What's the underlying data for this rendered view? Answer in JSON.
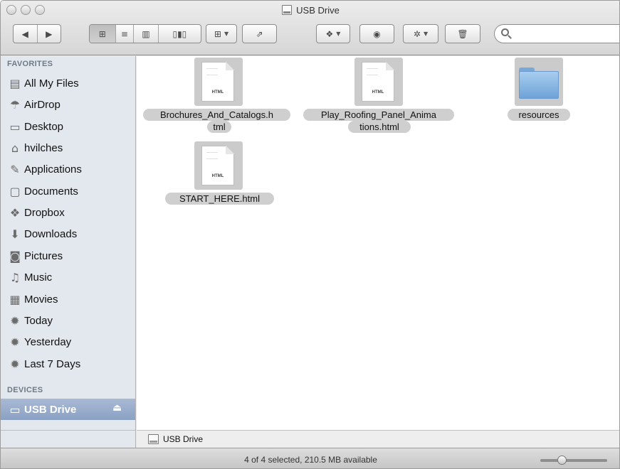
{
  "window": {
    "title": "USB Drive"
  },
  "toolbar": {
    "back_icon": "triangle-left-icon",
    "forward_icon": "triangle-right-icon",
    "views": [
      "icon-view",
      "list-view",
      "column-view",
      "coverflow-view"
    ],
    "active_view": "icon-view",
    "arrange_icon": "grid-icon",
    "share_icon": "share-icon",
    "dropbox_icon": "dropbox-icon",
    "quicklook_icon": "eye-icon",
    "action_icon": "gear-icon",
    "delete_icon": "trash-icon",
    "search_placeholder": ""
  },
  "sidebar": {
    "favorites_header": "FAVORITES",
    "favorites": [
      {
        "label": "All My Files",
        "icon": "all-files-icon"
      },
      {
        "label": "AirDrop",
        "icon": "airdrop-icon"
      },
      {
        "label": "Desktop",
        "icon": "desktop-icon"
      },
      {
        "label": "hvilches",
        "icon": "home-icon"
      },
      {
        "label": "Applications",
        "icon": "applications-icon"
      },
      {
        "label": "Documents",
        "icon": "documents-icon"
      },
      {
        "label": "Dropbox",
        "icon": "dropbox-icon"
      },
      {
        "label": "Downloads",
        "icon": "downloads-icon"
      },
      {
        "label": "Pictures",
        "icon": "camera-icon"
      },
      {
        "label": "Music",
        "icon": "music-icon"
      },
      {
        "label": "Movies",
        "icon": "film-icon"
      },
      {
        "label": "Today",
        "icon": "smart-folder-icon"
      },
      {
        "label": "Yesterday",
        "icon": "smart-folder-icon"
      },
      {
        "label": "Last 7 Days",
        "icon": "smart-folder-icon"
      }
    ],
    "devices_header": "DEVICES",
    "devices": [
      {
        "label": "USB Drive",
        "icon": "drive-icon",
        "selected": true
      }
    ]
  },
  "files": [
    {
      "name_line1": "Brochures_And_Catalogs.h",
      "name_line2": "tml",
      "kind": "html",
      "badge": "HTML"
    },
    {
      "name_line1": "Play_Roofing_Panel_Anima",
      "name_line2": "tions.html",
      "kind": "html",
      "badge": "HTML"
    },
    {
      "name_line1": "resources",
      "name_line2": "",
      "kind": "folder"
    },
    {
      "name_line1": "START_HERE.html",
      "name_line2": "",
      "kind": "html",
      "badge": "HTML"
    }
  ],
  "pathbar": {
    "label": "USB Drive"
  },
  "status": {
    "text": "4 of 4 selected, 210.5 MB available",
    "zoom_level": 0.3
  },
  "colors": {
    "selection": "#8ba1c4",
    "sidebar_bg": "#e3e8ee",
    "folder": "#6ea3d7"
  }
}
